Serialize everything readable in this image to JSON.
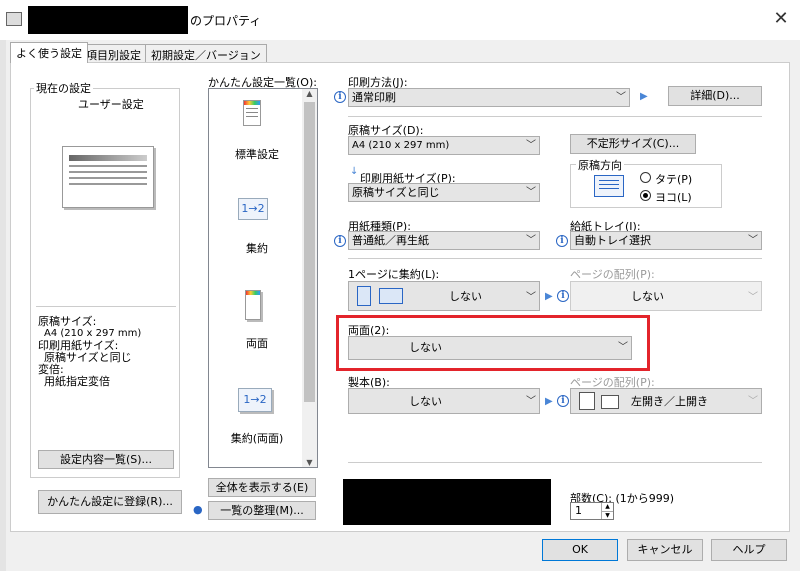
{
  "window": {
    "title_suffix": "のプロパティ",
    "close_glyph": "✕"
  },
  "tabs": [
    {
      "label": "よく使う設定"
    },
    {
      "label": "項目別設定"
    },
    {
      "label": "初期設定／バージョン"
    }
  ],
  "current": {
    "group_title": "現在の設定",
    "preset_name": "ユーザー設定",
    "summary": [
      "原稿サイズ:",
      "A4 (210 x 297 mm)",
      "印刷用紙サイズ:",
      "原稿サイズと同じ",
      "変倍:",
      "用紙指定変倍"
    ],
    "list_button": "設定内容一覧(S)..."
  },
  "register_button": "かんたん設定に登録(R)...",
  "easy": {
    "label": "かんたん設定一覧(O):",
    "items": [
      "標準設定",
      "集約",
      "両面",
      "集約(両面)"
    ],
    "icon_text": [
      "1→2",
      "1→2"
    ],
    "show_all_button": "全体を表示する(E)",
    "organize_button": "一覧の整理(M)..."
  },
  "settings": {
    "print_method": {
      "label": "印刷方法(J):",
      "value": "通常印刷",
      "detail_button": "詳細(D)..."
    },
    "original_size": {
      "label": "原稿サイズ(D):",
      "value": "A4 (210 x 297 mm)"
    },
    "custom_size_button": "不定形サイズ(C)...",
    "output_size": {
      "label": "印刷用紙サイズ(P):",
      "value": "原稿サイズと同じ"
    },
    "orientation": {
      "title": "原稿方向",
      "options": [
        "タテ(P)",
        "ヨコ(L)"
      ],
      "selected": "ヨコ(L)"
    },
    "paper_type": {
      "label": "用紙種類(P):",
      "value": "普通紙／再生紙"
    },
    "tray": {
      "label": "給紙トレイ(I):",
      "value": "自動トレイ選択"
    },
    "nup": {
      "label": "1ページに集約(L):",
      "value": "しない"
    },
    "page_order": {
      "label": "ページの配列(P):",
      "value": "しない"
    },
    "duplex": {
      "label": "両面(2):",
      "value": "しない"
    },
    "binding": {
      "label": "製本(B):",
      "value": "しない"
    },
    "page_order2": {
      "label": "ページの配列(P):",
      "value": "左開き／上開き"
    },
    "copies": {
      "label": "部数(C): (1から999)",
      "value": "1"
    }
  },
  "dialog_buttons": {
    "ok": "OK",
    "cancel": "キャンセル",
    "help": "ヘルプ"
  },
  "colors": {
    "highlight": "#e3242b",
    "info_blue": "#2a66c4"
  }
}
